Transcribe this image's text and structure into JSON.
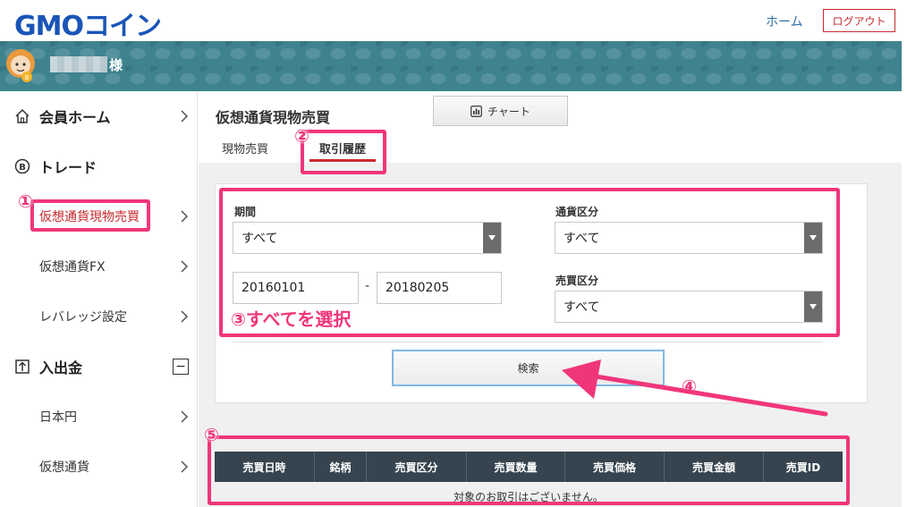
{
  "header": {
    "logo_text": "GMOコイン",
    "home_label": "ホーム",
    "logout_label": "ログアウト"
  },
  "user": {
    "suffix": "様"
  },
  "sidebar": {
    "items": [
      {
        "label": "会員ホーム",
        "icon": "home-icon"
      },
      {
        "label": "トレード",
        "icon": "bitcoin-icon"
      },
      {
        "label": "仮想通貨現物売買"
      },
      {
        "label": "仮想通貨FX"
      },
      {
        "label": "レバレッジ設定"
      },
      {
        "label": "入出金",
        "icon": "deposit-icon"
      },
      {
        "label": "日本円"
      },
      {
        "label": "仮想通貨"
      }
    ],
    "collapse_symbol": "−"
  },
  "main": {
    "title": "仮想通貨現物売買",
    "chart_button_label": "チャート",
    "tabs": [
      {
        "label": "現物売買"
      },
      {
        "label": "取引履歴"
      }
    ],
    "filters": {
      "period_label": "期間",
      "period_value": "すべて",
      "date_from": "20160101",
      "date_separator": "-",
      "date_to": "20180205",
      "currency_type_label": "通貨区分",
      "currency_type_value": "すべて",
      "trade_type_label": "売買区分",
      "trade_type_value": "すべて"
    },
    "search_label": "検索",
    "table": {
      "headers": [
        "売買日時",
        "銘柄",
        "売買区分",
        "売買数量",
        "売買価格",
        "売買金額",
        "売買ID"
      ],
      "empty_message": "対象のお取引はございません。"
    }
  },
  "annotations": {
    "step1": "①",
    "step2": "②",
    "step3_text": "③すべてを選択",
    "step4": "④",
    "step5": "⑤",
    "color": "#f0367a"
  },
  "colors": {
    "brand_blue": "#1a55b7",
    "logout_red": "#c8292f",
    "banner_teal": "#3f8390",
    "table_header": "#36444f",
    "active_tab_underline": "#c8292f"
  }
}
